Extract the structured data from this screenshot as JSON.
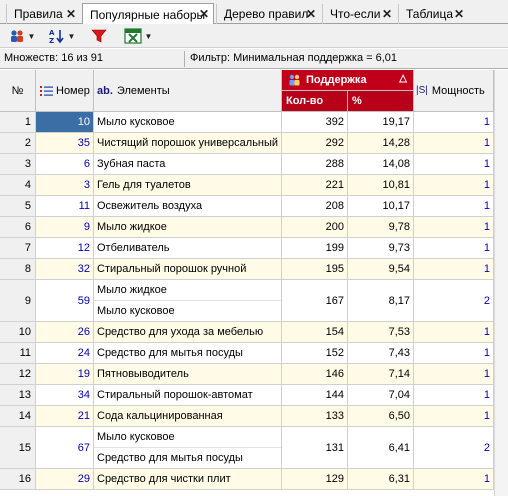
{
  "tabs": [
    {
      "label": "Правила"
    },
    {
      "label": "Популярные наборы"
    },
    {
      "label": "Дерево правил"
    },
    {
      "label": "Что-если"
    },
    {
      "label": "Таблица"
    }
  ],
  "tab_close_glyph": "✕",
  "active_tab_index": 1,
  "toolbar": {
    "icons": [
      "group-icon",
      "sort-az-icon",
      "filter-icon",
      "excel-export-icon"
    ]
  },
  "status": {
    "set_count": "Множеств: 16 из 91",
    "filter": "Фильтр: Минимальная поддержка = 6,01"
  },
  "columns": {
    "index": "№",
    "number": "Номер",
    "elements_prefix": "ab.",
    "elements": "Элементы",
    "support": "Поддержка",
    "count": "Кол-во",
    "percent": "%",
    "power_prefix": "|S|",
    "power": "Мощность"
  },
  "colors": {
    "support_header": "#c0001a",
    "odd_row": "#fffbe6",
    "selected": "#3a6ea5"
  },
  "rows": [
    {
      "idx": "1",
      "num": "10",
      "items": [
        "Мыло кусковое"
      ],
      "count": "392",
      "pct": "19,17",
      "power": "1"
    },
    {
      "idx": "2",
      "num": "35",
      "items": [
        "Чистящий порошок универсальный"
      ],
      "count": "292",
      "pct": "14,28",
      "power": "1"
    },
    {
      "idx": "3",
      "num": "6",
      "items": [
        "Зубная паста"
      ],
      "count": "288",
      "pct": "14,08",
      "power": "1"
    },
    {
      "idx": "4",
      "num": "3",
      "items": [
        "Гель для туалетов"
      ],
      "count": "221",
      "pct": "10,81",
      "power": "1"
    },
    {
      "idx": "5",
      "num": "11",
      "items": [
        "Освежитель воздуха"
      ],
      "count": "208",
      "pct": "10,17",
      "power": "1"
    },
    {
      "idx": "6",
      "num": "9",
      "items": [
        "Мыло жидкое"
      ],
      "count": "200",
      "pct": "9,78",
      "power": "1"
    },
    {
      "idx": "7",
      "num": "12",
      "items": [
        "Отбеливатель"
      ],
      "count": "199",
      "pct": "9,73",
      "power": "1"
    },
    {
      "idx": "8",
      "num": "32",
      "items": [
        "Стиральный порошок ручной"
      ],
      "count": "195",
      "pct": "9,54",
      "power": "1"
    },
    {
      "idx": "9",
      "num": "59",
      "items": [
        "Мыло жидкое",
        "Мыло кусковое"
      ],
      "count": "167",
      "pct": "8,17",
      "power": "2"
    },
    {
      "idx": "10",
      "num": "26",
      "items": [
        "Средство для ухода за мебелью"
      ],
      "count": "154",
      "pct": "7,53",
      "power": "1"
    },
    {
      "idx": "11",
      "num": "24",
      "items": [
        "Средство для мытья посуды"
      ],
      "count": "152",
      "pct": "7,43",
      "power": "1"
    },
    {
      "idx": "12",
      "num": "19",
      "items": [
        "Пятновыводитель"
      ],
      "count": "146",
      "pct": "7,14",
      "power": "1"
    },
    {
      "idx": "13",
      "num": "34",
      "items": [
        "Стиральный порошок-автомат"
      ],
      "count": "144",
      "pct": "7,04",
      "power": "1"
    },
    {
      "idx": "14",
      "num": "21",
      "items": [
        "Сода кальцинированная"
      ],
      "count": "133",
      "pct": "6,50",
      "power": "1"
    },
    {
      "idx": "15",
      "num": "67",
      "items": [
        "Мыло кусковое",
        "Средство для мытья посуды"
      ],
      "count": "131",
      "pct": "6,41",
      "power": "2"
    },
    {
      "idx": "16",
      "num": "29",
      "items": [
        "Средство для чистки плит"
      ],
      "count": "129",
      "pct": "6,31",
      "power": "1"
    }
  ]
}
